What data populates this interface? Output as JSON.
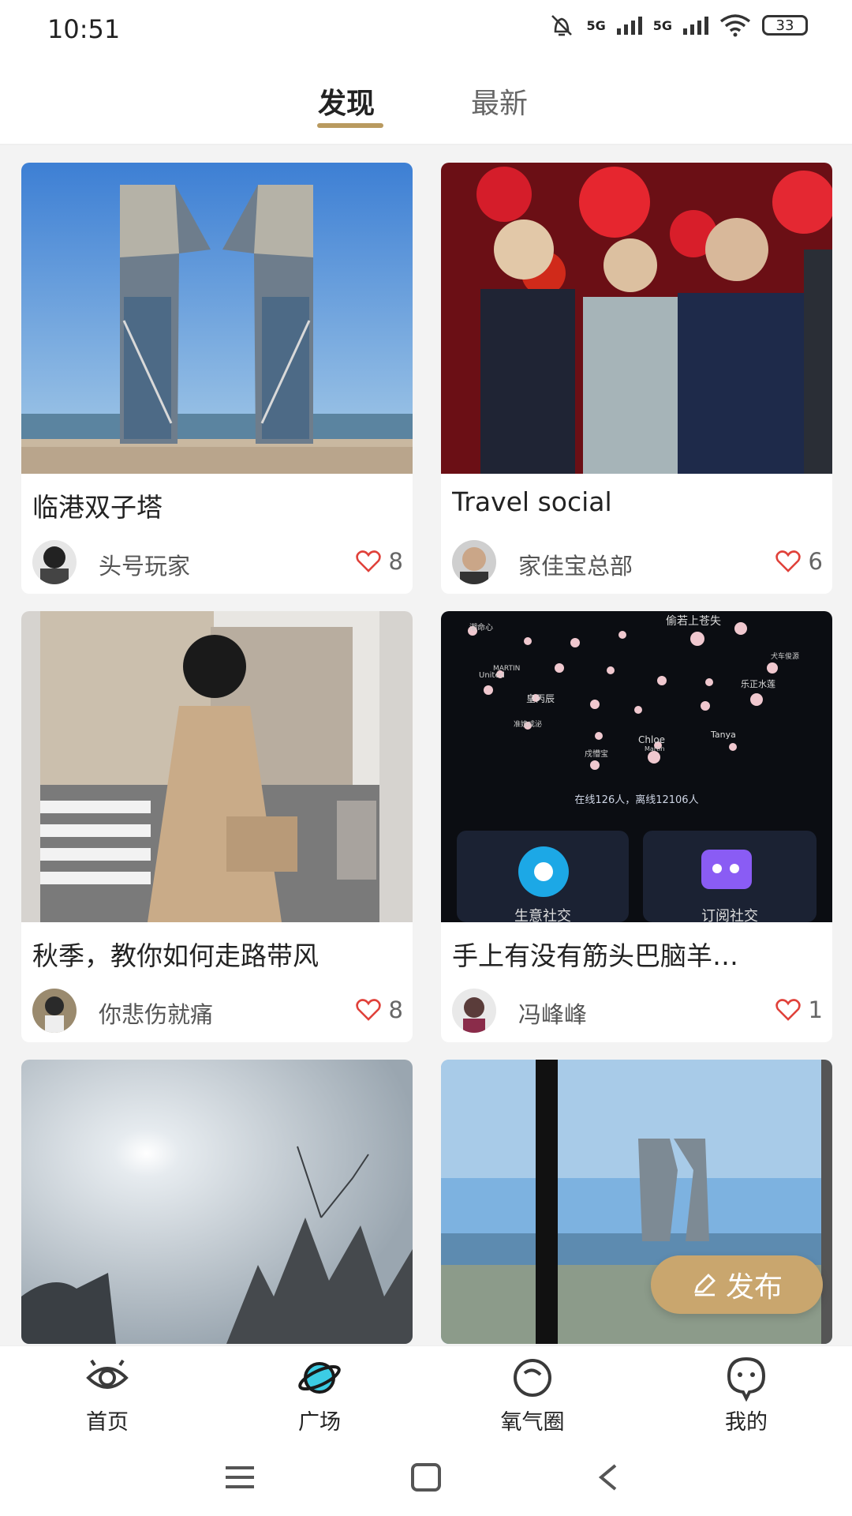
{
  "status_bar": {
    "time": "10:51",
    "network_1": "5G",
    "network_2": "5G",
    "battery": "33"
  },
  "tabs": [
    {
      "label": "发现",
      "active": true
    },
    {
      "label": "最新",
      "active": false
    }
  ],
  "feed": [
    {
      "title": "临港双子塔",
      "author": "头号玩家",
      "likes": "8"
    },
    {
      "title": "Travel social",
      "author": "家佳宝总部",
      "likes": "6"
    },
    {
      "title": "秋季，教你如何走路带风",
      "author": "你悲伤就痛",
      "likes": "8"
    },
    {
      "title": "手上有没有筋头巴脑羊…",
      "author": "冯峰峰",
      "likes": "1",
      "image_text": {
        "names": [
          "偷若上苍失",
          "潮命心",
          "MARTIN",
          "United",
          "皇丙辰",
          "乐正水莲",
          "犬车俊源",
          "Chloe",
          "Martin",
          "Tanya",
          "戍懵宝",
          "准娩成泌"
        ],
        "online_text": "在线126人，离线12106人",
        "btn_left": "生意社交",
        "btn_right": "订阅社交"
      }
    },
    {
      "title": "",
      "author": "",
      "likes": ""
    },
    {
      "title": "",
      "author": "",
      "likes": ""
    }
  ],
  "publish_button": {
    "label": "发布"
  },
  "bottom_nav": [
    {
      "label": "首页",
      "icon": "eye-icon"
    },
    {
      "label": "广场",
      "icon": "planet-icon",
      "active": true
    },
    {
      "label": "氧气圈",
      "icon": "circle-icon"
    },
    {
      "label": "我的",
      "icon": "chat-face-icon"
    }
  ],
  "colors": {
    "accent": "#b99a5f",
    "publish": "#c9a66e",
    "heart": "#e0413a",
    "planet": "#3ccce4"
  }
}
